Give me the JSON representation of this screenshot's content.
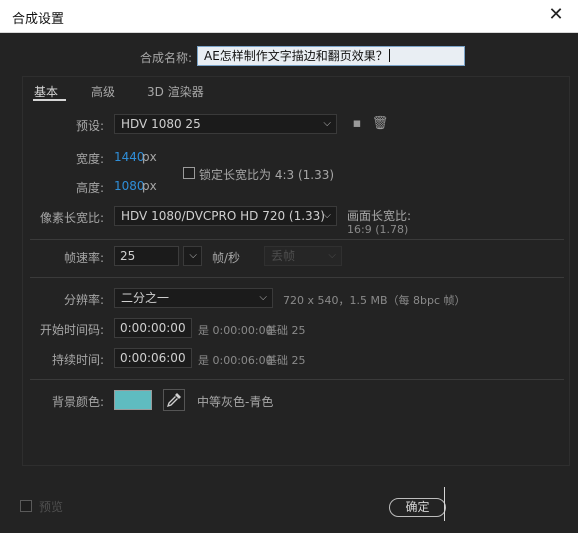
{
  "window": {
    "title": "合成设置"
  },
  "comp_name": {
    "label": "合成名称:",
    "value": "AE怎样制作文字描边和翻页效果？"
  },
  "tabs": [
    {
      "label": "基本",
      "active": true
    },
    {
      "label": "高级",
      "active": false
    },
    {
      "label": "3D 渲染器",
      "active": false
    }
  ],
  "preset": {
    "label": "预设:",
    "value": "HDV 1080 25"
  },
  "width": {
    "label": "宽度:",
    "value": "1440",
    "unit": "px"
  },
  "height": {
    "label": "高度:",
    "value": "1080",
    "unit": "px"
  },
  "aspect_lock": {
    "label": "锁定长宽比为 4:3 (1.33)",
    "checked": false
  },
  "pixel_aspect": {
    "label": "像素长宽比:",
    "value": "HDV 1080/DVCPRO HD 720 (1.33)"
  },
  "frame_aspect": {
    "label": "画面长宽比:",
    "value": "16:9 (1.78)"
  },
  "frame_rate": {
    "label": "帧速率:",
    "value": "25",
    "unit": "帧/秒",
    "drop_mode": "丢帧"
  },
  "resolution": {
    "label": "分辨率:",
    "value": "二分之一",
    "info": "720 x 540，1.5 MB（每 8bpc 帧）"
  },
  "start_timecode": {
    "label": "开始时间码:",
    "value": "0:00:00:00",
    "is_label": "是 0:00:00:00",
    "base_label": "基础 25"
  },
  "duration": {
    "label": "持续时间:",
    "value": "0:00:06:00",
    "is_label": "是 0:00:06:00",
    "base_label": "基础 25"
  },
  "background": {
    "label": "背景颜色:",
    "color_name": "中等灰色-青色",
    "color": "#5fbcc0"
  },
  "footer": {
    "preview_label": "预览",
    "ok_label": "确定"
  },
  "icons": {
    "close": "close-icon",
    "eyedropper": "eyedropper-icon",
    "delete": "trash-icon",
    "save": "save-preset-icon"
  }
}
